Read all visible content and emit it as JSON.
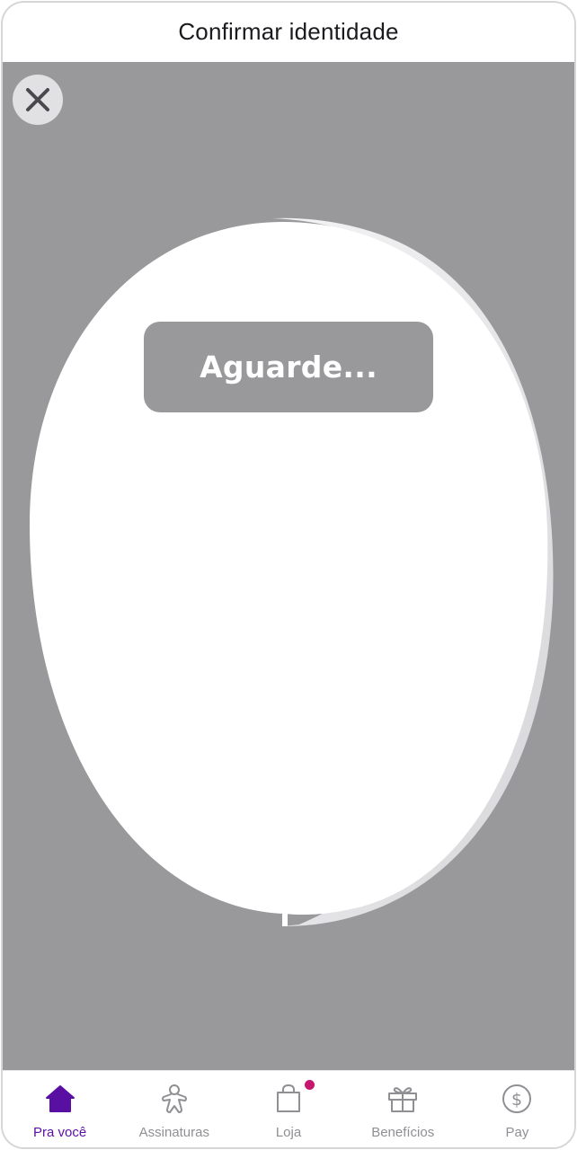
{
  "header": {
    "title": "Confirmar identidade"
  },
  "camera": {
    "status_text": "Aguarde..."
  },
  "colors": {
    "accent": "#5a0fa3",
    "overlay": "#99989b",
    "badge": "#c6166d"
  },
  "icons": {
    "close": "close-icon",
    "home": "home-icon",
    "subscriptions": "gingerbread-person-icon",
    "store": "shopping-bag-icon",
    "benefits": "gift-icon",
    "pay": "dollar-circle-icon"
  },
  "bottom_nav": {
    "items": [
      {
        "label": "Pra você",
        "active": true
      },
      {
        "label": "Assinaturas",
        "active": false
      },
      {
        "label": "Loja",
        "active": false,
        "badge": true
      },
      {
        "label": "Benefícios",
        "active": false
      },
      {
        "label": "Pay",
        "active": false
      }
    ]
  }
}
